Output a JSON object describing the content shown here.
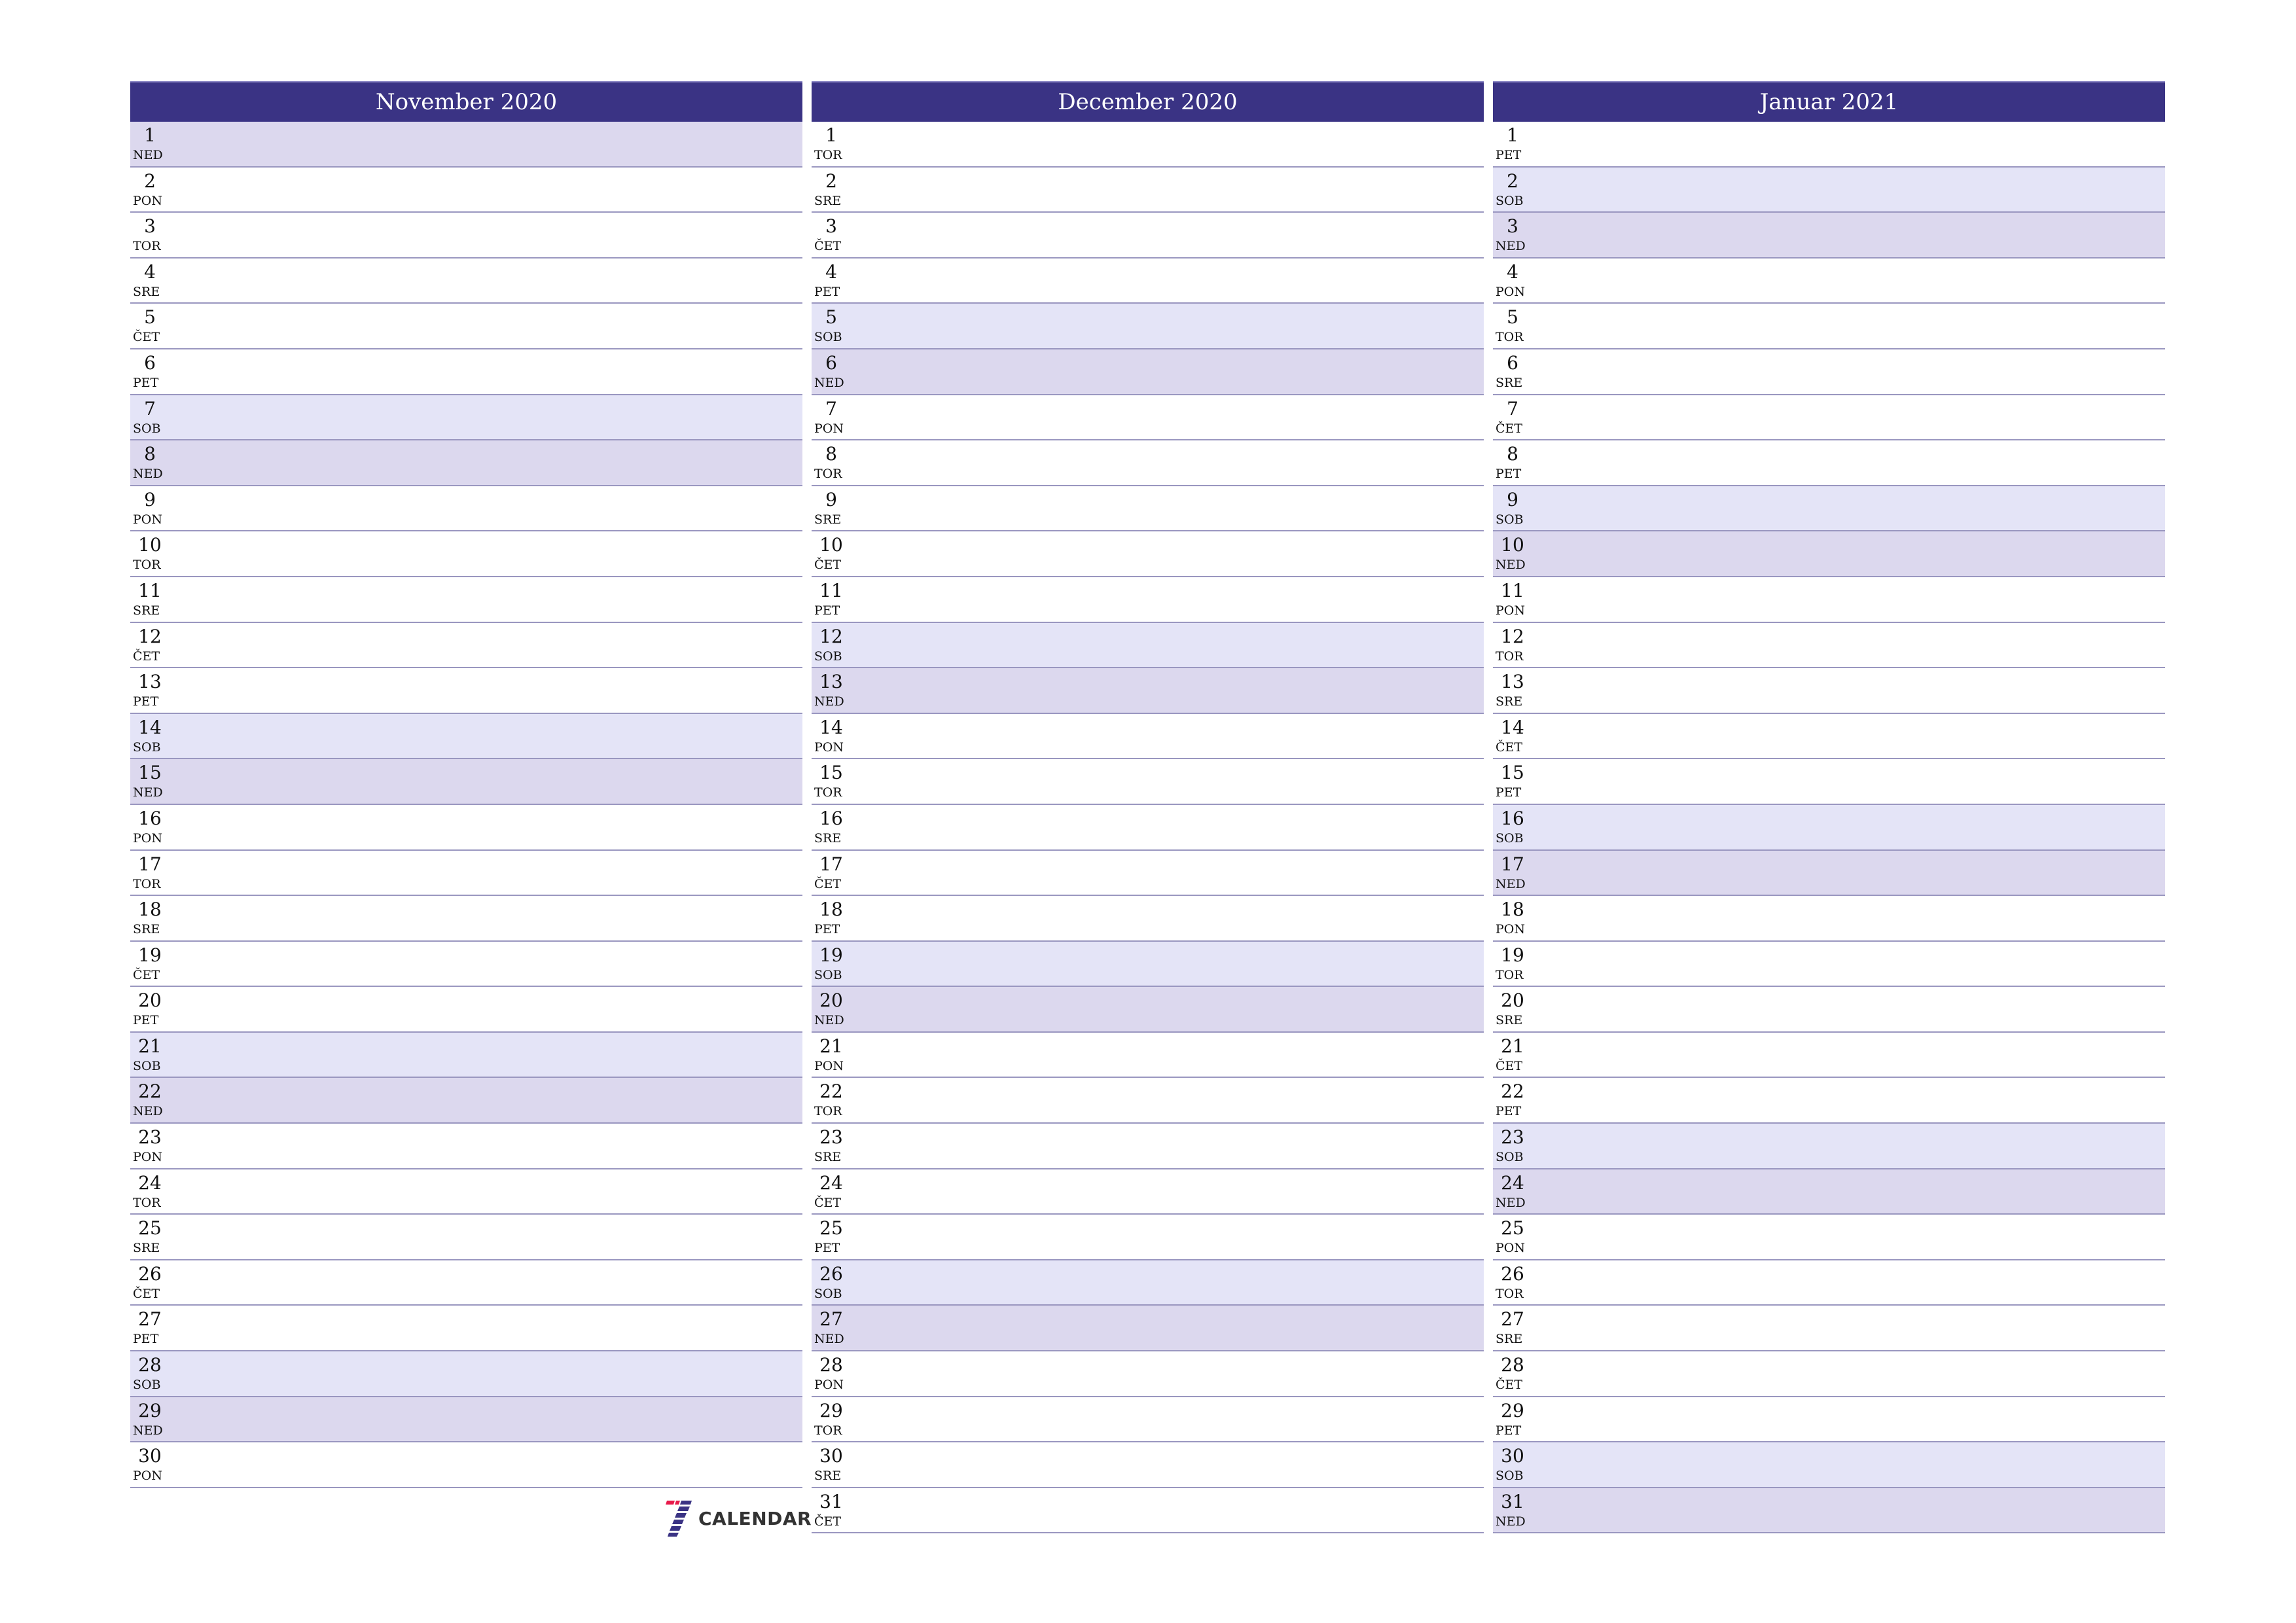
{
  "colors": {
    "header": "#3a3384",
    "saturday": "#e4e4f7",
    "sunday": "#dcd8ee",
    "border": "#9a97c0"
  },
  "months": [
    {
      "title": "November 2020",
      "days": [
        {
          "n": "1",
          "d": "NED"
        },
        {
          "n": "2",
          "d": "PON"
        },
        {
          "n": "3",
          "d": "TOR"
        },
        {
          "n": "4",
          "d": "SRE"
        },
        {
          "n": "5",
          "d": "ČET"
        },
        {
          "n": "6",
          "d": "PET"
        },
        {
          "n": "7",
          "d": "SOB"
        },
        {
          "n": "8",
          "d": "NED"
        },
        {
          "n": "9",
          "d": "PON"
        },
        {
          "n": "10",
          "d": "TOR"
        },
        {
          "n": "11",
          "d": "SRE"
        },
        {
          "n": "12",
          "d": "ČET"
        },
        {
          "n": "13",
          "d": "PET"
        },
        {
          "n": "14",
          "d": "SOB"
        },
        {
          "n": "15",
          "d": "NED"
        },
        {
          "n": "16",
          "d": "PON"
        },
        {
          "n": "17",
          "d": "TOR"
        },
        {
          "n": "18",
          "d": "SRE"
        },
        {
          "n": "19",
          "d": "ČET"
        },
        {
          "n": "20",
          "d": "PET"
        },
        {
          "n": "21",
          "d": "SOB"
        },
        {
          "n": "22",
          "d": "NED"
        },
        {
          "n": "23",
          "d": "PON"
        },
        {
          "n": "24",
          "d": "TOR"
        },
        {
          "n": "25",
          "d": "SRE"
        },
        {
          "n": "26",
          "d": "ČET"
        },
        {
          "n": "27",
          "d": "PET"
        },
        {
          "n": "28",
          "d": "SOB"
        },
        {
          "n": "29",
          "d": "NED"
        },
        {
          "n": "30",
          "d": "PON"
        }
      ]
    },
    {
      "title": "December 2020",
      "days": [
        {
          "n": "1",
          "d": "TOR"
        },
        {
          "n": "2",
          "d": "SRE"
        },
        {
          "n": "3",
          "d": "ČET"
        },
        {
          "n": "4",
          "d": "PET"
        },
        {
          "n": "5",
          "d": "SOB"
        },
        {
          "n": "6",
          "d": "NED"
        },
        {
          "n": "7",
          "d": "PON"
        },
        {
          "n": "8",
          "d": "TOR"
        },
        {
          "n": "9",
          "d": "SRE"
        },
        {
          "n": "10",
          "d": "ČET"
        },
        {
          "n": "11",
          "d": "PET"
        },
        {
          "n": "12",
          "d": "SOB"
        },
        {
          "n": "13",
          "d": "NED"
        },
        {
          "n": "14",
          "d": "PON"
        },
        {
          "n": "15",
          "d": "TOR"
        },
        {
          "n": "16",
          "d": "SRE"
        },
        {
          "n": "17",
          "d": "ČET"
        },
        {
          "n": "18",
          "d": "PET"
        },
        {
          "n": "19",
          "d": "SOB"
        },
        {
          "n": "20",
          "d": "NED"
        },
        {
          "n": "21",
          "d": "PON"
        },
        {
          "n": "22",
          "d": "TOR"
        },
        {
          "n": "23",
          "d": "SRE"
        },
        {
          "n": "24",
          "d": "ČET"
        },
        {
          "n": "25",
          "d": "PET"
        },
        {
          "n": "26",
          "d": "SOB"
        },
        {
          "n": "27",
          "d": "NED"
        },
        {
          "n": "28",
          "d": "PON"
        },
        {
          "n": "29",
          "d": "TOR"
        },
        {
          "n": "30",
          "d": "SRE"
        },
        {
          "n": "31",
          "d": "ČET"
        }
      ]
    },
    {
      "title": "Januar 2021",
      "days": [
        {
          "n": "1",
          "d": "PET"
        },
        {
          "n": "2",
          "d": "SOB"
        },
        {
          "n": "3",
          "d": "NED"
        },
        {
          "n": "4",
          "d": "PON"
        },
        {
          "n": "5",
          "d": "TOR"
        },
        {
          "n": "6",
          "d": "SRE"
        },
        {
          "n": "7",
          "d": "ČET"
        },
        {
          "n": "8",
          "d": "PET"
        },
        {
          "n": "9",
          "d": "SOB"
        },
        {
          "n": "10",
          "d": "NED"
        },
        {
          "n": "11",
          "d": "PON"
        },
        {
          "n": "12",
          "d": "TOR"
        },
        {
          "n": "13",
          "d": "SRE"
        },
        {
          "n": "14",
          "d": "ČET"
        },
        {
          "n": "15",
          "d": "PET"
        },
        {
          "n": "16",
          "d": "SOB"
        },
        {
          "n": "17",
          "d": "NED"
        },
        {
          "n": "18",
          "d": "PON"
        },
        {
          "n": "19",
          "d": "TOR"
        },
        {
          "n": "20",
          "d": "SRE"
        },
        {
          "n": "21",
          "d": "ČET"
        },
        {
          "n": "22",
          "d": "PET"
        },
        {
          "n": "23",
          "d": "SOB"
        },
        {
          "n": "24",
          "d": "NED"
        },
        {
          "n": "25",
          "d": "PON"
        },
        {
          "n": "26",
          "d": "TOR"
        },
        {
          "n": "27",
          "d": "SRE"
        },
        {
          "n": "28",
          "d": "ČET"
        },
        {
          "n": "29",
          "d": "PET"
        },
        {
          "n": "30",
          "d": "SOB"
        },
        {
          "n": "31",
          "d": "NED"
        }
      ]
    }
  ],
  "weekend": {
    "saturday": "SOB",
    "sunday": "NED"
  },
  "logo": {
    "text": "CALENDAR",
    "icon": "seven-calendar-logo-icon"
  }
}
